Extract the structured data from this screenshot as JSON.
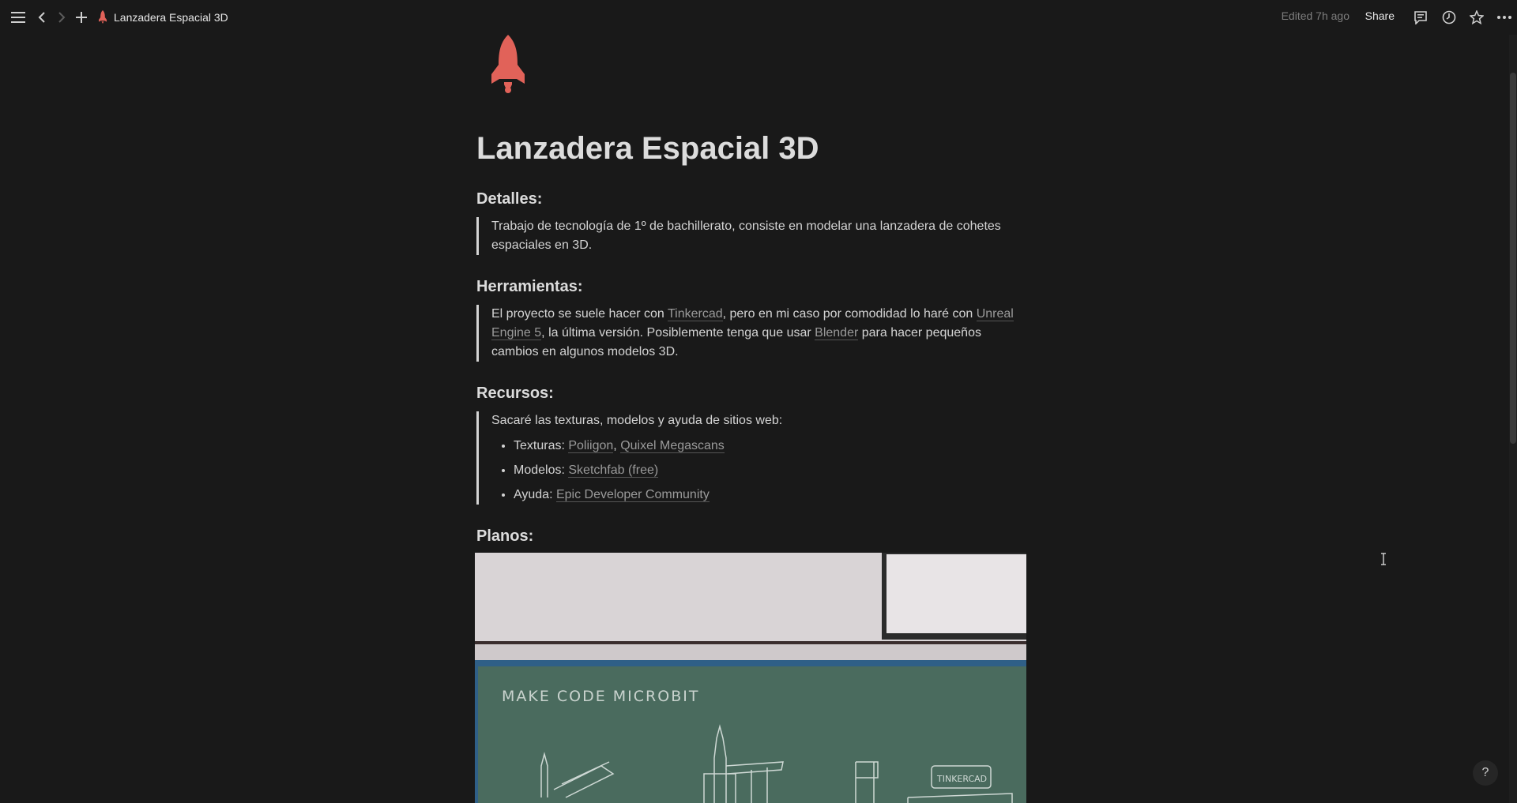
{
  "topbar": {
    "page_title": "Lanzadera Espacial 3D",
    "edited": "Edited 7h ago",
    "share_label": "Share"
  },
  "page": {
    "icon": "rocket-icon",
    "title": "Lanzadera Espacial 3D",
    "sections": {
      "detalles": {
        "heading": "Detalles:",
        "text": "Trabajo de tecnología de 1º de bachillerato, consiste en modelar una lanzadera de cohetes espaciales en 3D."
      },
      "herramientas": {
        "heading": "Herramientas:",
        "t1": "El proyecto se suele hacer con ",
        "link1": "Tinkercad",
        "t2": ", pero en mi caso por comodidad lo haré con ",
        "link2": "Unreal Engine 5",
        "t3": ", la última versión. Posiblemente tenga que usar ",
        "link3": "Blender",
        "t4": " para hacer pequeños cambios en algunos modelos 3D."
      },
      "recursos": {
        "heading": "Recursos:",
        "intro": "Sacaré las texturas, modelos y ayuda de sitios web:",
        "items": [
          {
            "label": "Texturas: ",
            "links": [
              "Poliigon",
              "Quixel Megascans"
            ],
            "sep": ", "
          },
          {
            "label": "Modelos: ",
            "links": [
              "Sketchfab (free)"
            ]
          },
          {
            "label": "Ayuda: ",
            "links": [
              "Epic Developer Community"
            ]
          }
        ]
      },
      "planos": {
        "heading": "Planos:",
        "image_text": {
          "board_title": "MAKE CODE   MICROBIT",
          "board_label": "TINKERCAD"
        }
      }
    }
  },
  "help_label": "?",
  "colors": {
    "background": "#191919",
    "text": "#d4d4d4",
    "accent": "#e16259",
    "link": "#9a9a9a"
  }
}
